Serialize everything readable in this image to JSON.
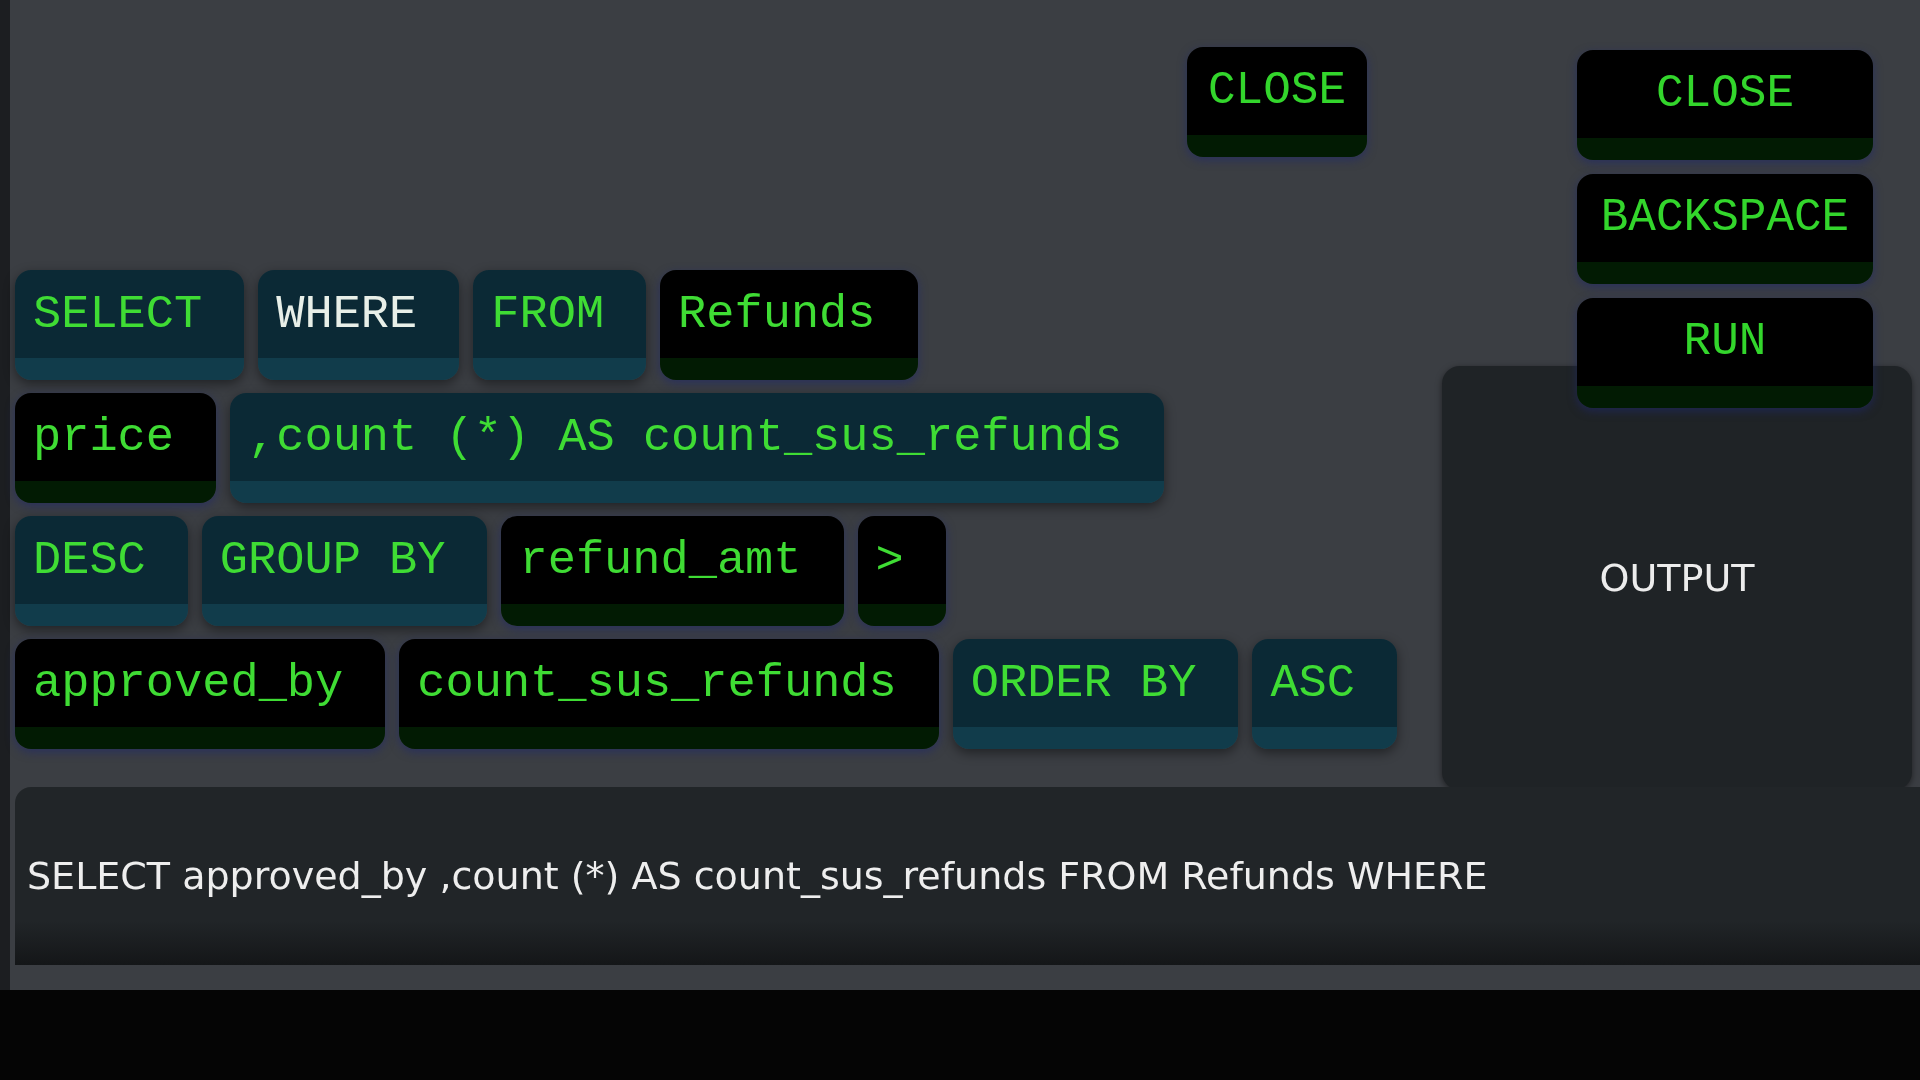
{
  "top_button": {
    "label": "CLOSE"
  },
  "token_rows": [
    [
      {
        "label": "SELECT",
        "kind": "keyword",
        "highlighted": false
      },
      {
        "label": "WHERE",
        "kind": "keyword",
        "highlighted": true
      },
      {
        "label": "FROM",
        "kind": "keyword",
        "highlighted": false
      },
      {
        "label": "Refunds",
        "kind": "value",
        "highlighted": false
      }
    ],
    [
      {
        "label": "price",
        "kind": "value",
        "highlighted": false
      },
      {
        "label": ",count (*) AS count_sus_refunds",
        "kind": "keyword",
        "highlighted": false
      }
    ],
    [
      {
        "label": "DESC",
        "kind": "keyword",
        "highlighted": false
      },
      {
        "label": "GROUP BY",
        "kind": "keyword",
        "highlighted": false
      },
      {
        "label": "refund_amt",
        "kind": "value",
        "highlighted": false
      },
      {
        "label": ">",
        "kind": "value",
        "highlighted": false
      }
    ],
    [
      {
        "label": "approved_by",
        "kind": "value",
        "highlighted": false
      },
      {
        "label": "count_sus_refunds",
        "kind": "value",
        "highlighted": false
      },
      {
        "label": "ORDER BY",
        "kind": "keyword",
        "highlighted": false
      },
      {
        "label": "ASC",
        "kind": "keyword",
        "highlighted": false
      }
    ]
  ],
  "side_buttons": [
    "CLOSE",
    "BACKSPACE",
    "RUN"
  ],
  "output": {
    "label": "OUTPUT"
  },
  "query": "SELECT approved_by ,count (*) AS count_sus_refunds FROM Refunds WHERE"
}
